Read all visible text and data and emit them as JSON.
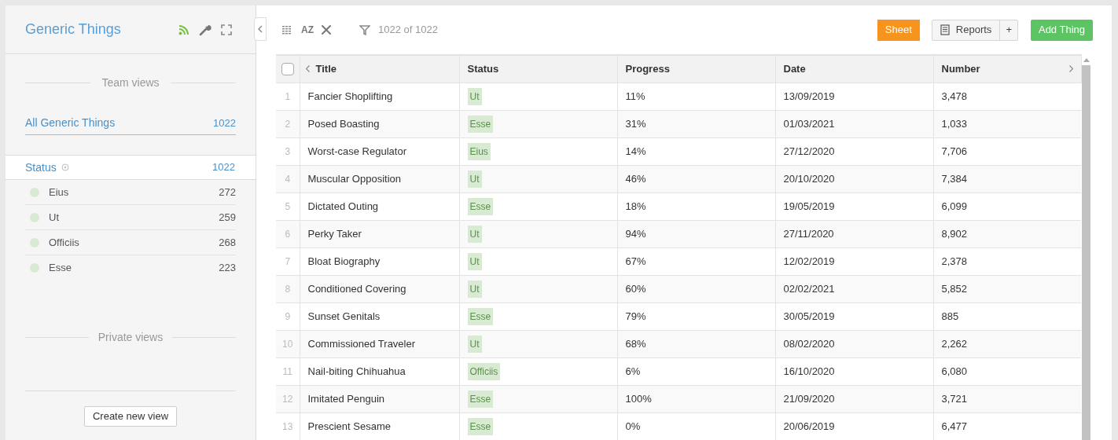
{
  "sidebar": {
    "title": "Generic Things",
    "team_views_heading": "Team views",
    "views": [
      {
        "label": "All Generic Things",
        "count": "1022",
        "selected": true
      }
    ],
    "filter_group": {
      "label": "Status",
      "count": "1022"
    },
    "status_items": [
      {
        "label": "Eius",
        "count": "272"
      },
      {
        "label": "Ut",
        "count": "259"
      },
      {
        "label": "Officiis",
        "count": "268"
      },
      {
        "label": "Esse",
        "count": "223"
      }
    ],
    "private_views_heading": "Private views",
    "create_button": "Create new view"
  },
  "toolbar": {
    "sort_label": "AZ",
    "record_count": "1022 of 1022",
    "sheet_button": "Sheet",
    "reports_button": "Reports",
    "reports_add": "+",
    "add_button": "Add Thing"
  },
  "table": {
    "select_all_checked": false,
    "columns": [
      "Title",
      "Status",
      "Progress",
      "Date",
      "Number"
    ],
    "rows": [
      {
        "n": "1",
        "title": "Fancier Shoplifting",
        "status": "Ut",
        "progress": "11%",
        "date": "13/09/2019",
        "number": "3,478"
      },
      {
        "n": "2",
        "title": "Posed Boasting",
        "status": "Esse",
        "progress": "31%",
        "date": "01/03/2021",
        "number": "1,033"
      },
      {
        "n": "3",
        "title": "Worst-case Regulator",
        "status": "Eius",
        "progress": "14%",
        "date": "27/12/2020",
        "number": "7,706"
      },
      {
        "n": "4",
        "title": "Muscular Opposition",
        "status": "Ut",
        "progress": "46%",
        "date": "20/10/2020",
        "number": "7,384"
      },
      {
        "n": "5",
        "title": "Dictated Outing",
        "status": "Esse",
        "progress": "18%",
        "date": "19/05/2019",
        "number": "6,099"
      },
      {
        "n": "6",
        "title": "Perky Taker",
        "status": "Ut",
        "progress": "94%",
        "date": "27/11/2020",
        "number": "8,902"
      },
      {
        "n": "7",
        "title": "Bloat Biography",
        "status": "Ut",
        "progress": "67%",
        "date": "12/02/2019",
        "number": "2,378"
      },
      {
        "n": "8",
        "title": "Conditioned Covering",
        "status": "Ut",
        "progress": "60%",
        "date": "02/02/2021",
        "number": "5,852"
      },
      {
        "n": "9",
        "title": "Sunset Genitals",
        "status": "Esse",
        "progress": "79%",
        "date": "30/05/2019",
        "number": "885"
      },
      {
        "n": "10",
        "title": "Commissioned Traveler",
        "status": "Ut",
        "progress": "68%",
        "date": "08/02/2020",
        "number": "2,262"
      },
      {
        "n": "11",
        "title": "Nail-biting Chihuahua",
        "status": "Officiis",
        "progress": "6%",
        "date": "16/10/2020",
        "number": "6,080"
      },
      {
        "n": "12",
        "title": "Imitated Penguin",
        "status": "Esse",
        "progress": "100%",
        "date": "21/09/2020",
        "number": "3,721"
      },
      {
        "n": "13",
        "title": "Prescient Sesame",
        "status": "Esse",
        "progress": "0%",
        "date": "20/06/2019",
        "number": "6,477"
      }
    ]
  }
}
